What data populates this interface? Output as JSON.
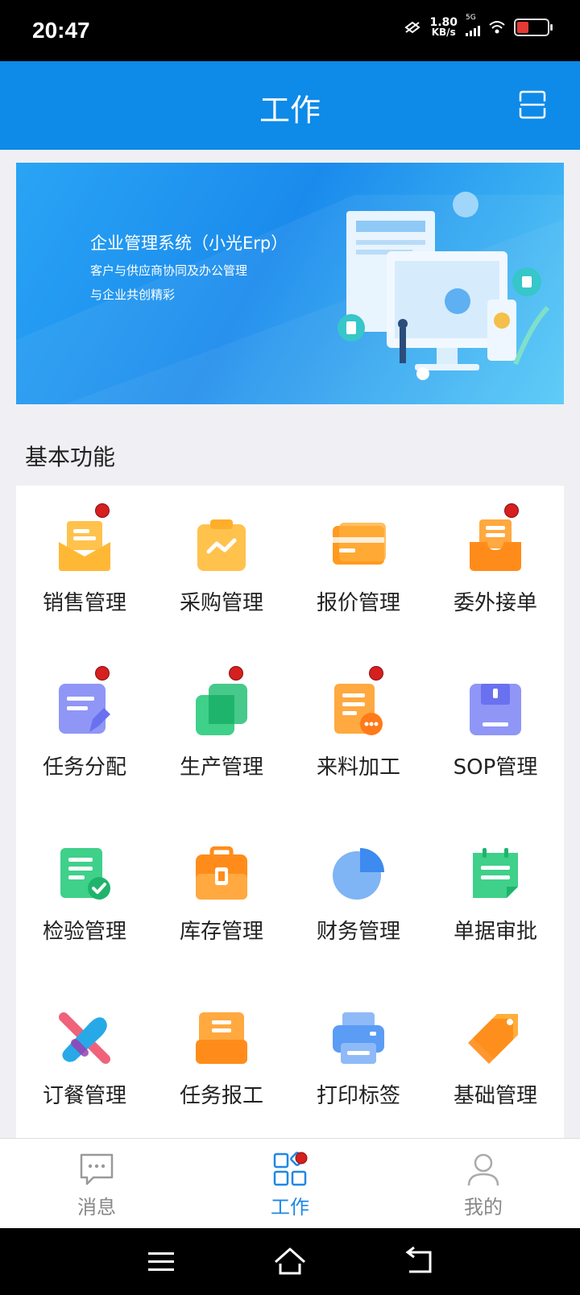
{
  "status_bar": {
    "time": "20:47",
    "speed_value": "1.80",
    "speed_unit": "KB/s",
    "network": "5G"
  },
  "header": {
    "title": "工作"
  },
  "banner": {
    "title": "企业管理系统（小光Erp）",
    "line1": "客户与供应商协同及办公管理",
    "line2": "与企业共创精彩"
  },
  "section": {
    "title": "基本功能"
  },
  "features": [
    {
      "label": "销售管理",
      "icon": "inbox-icon",
      "badge": true
    },
    {
      "label": "采购管理",
      "icon": "clipboard-chart-icon",
      "badge": false
    },
    {
      "label": "报价管理",
      "icon": "card-icon",
      "badge": false
    },
    {
      "label": "委外接单",
      "icon": "tray-icon",
      "badge": true
    },
    {
      "label": "任务分配",
      "icon": "edit-doc-icon",
      "badge": true
    },
    {
      "label": "生产管理",
      "icon": "layers-icon",
      "badge": true
    },
    {
      "label": "来料加工",
      "icon": "doc-more-icon",
      "badge": true
    },
    {
      "label": "SOP管理",
      "icon": "floppy-icon",
      "badge": false
    },
    {
      "label": "检验管理",
      "icon": "doc-check-icon",
      "badge": false
    },
    {
      "label": "库存管理",
      "icon": "toolbox-icon",
      "badge": false
    },
    {
      "label": "财务管理",
      "icon": "pie-icon",
      "badge": false
    },
    {
      "label": "单据审批",
      "icon": "note-icon",
      "badge": false
    },
    {
      "label": "订餐管理",
      "icon": "utensils-icon",
      "badge": false
    },
    {
      "label": "任务报工",
      "icon": "archive-icon",
      "badge": false
    },
    {
      "label": "打印标签",
      "icon": "printer-icon",
      "badge": false
    },
    {
      "label": "基础管理",
      "icon": "tag-icon",
      "badge": false
    }
  ],
  "tabs": [
    {
      "label": "消息",
      "icon": "chat-icon",
      "active": false
    },
    {
      "label": "工作",
      "icon": "grid-icon",
      "active": true
    },
    {
      "label": "我的",
      "icon": "user-icon",
      "active": false
    }
  ],
  "colors": {
    "primary": "#0e8ae8",
    "active_tab": "#1e88e5",
    "badge": "#d61f1f"
  }
}
